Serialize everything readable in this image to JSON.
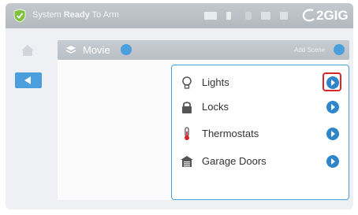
{
  "status_bar": {
    "status_prefix": "System ",
    "status_bold": "Ready",
    "status_suffix": " To Arm",
    "brand": "2GIG"
  },
  "scene": {
    "name": "Movie",
    "right_label": "Add Scene"
  },
  "menu": {
    "items": [
      {
        "label": "Lights",
        "icon": "lightbulb-icon"
      },
      {
        "label": "Locks",
        "icon": "lock-icon"
      },
      {
        "label": "Thermostats",
        "icon": "thermometer-icon"
      },
      {
        "label": "Garage Doors",
        "icon": "garage-icon"
      }
    ]
  },
  "colors": {
    "accent": "#4a9fdc",
    "highlight": "#d9262b",
    "topbar": "#b8bdc4"
  }
}
